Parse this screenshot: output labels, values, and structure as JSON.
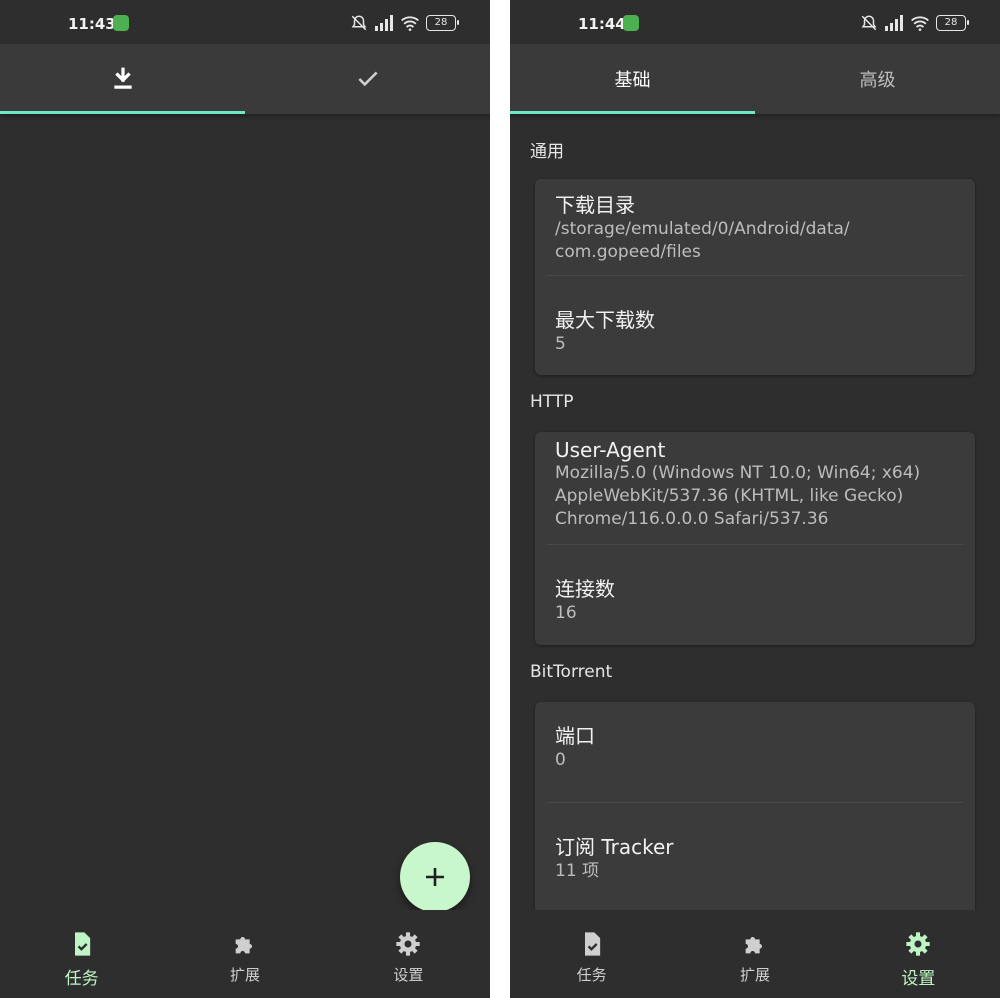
{
  "left": {
    "status": {
      "time": "11:43",
      "battery": "28"
    },
    "tabs": [
      {
        "icon": "download-icon",
        "active": true
      },
      {
        "icon": "check-icon",
        "active": false
      }
    ],
    "fab": {
      "icon": "plus-icon"
    },
    "nav": [
      {
        "label": "任务",
        "icon": "task-icon",
        "active": true
      },
      {
        "label": "扩展",
        "icon": "puzzle-icon",
        "active": false
      },
      {
        "label": "设置",
        "icon": "gear-icon",
        "active": false
      }
    ]
  },
  "right": {
    "status": {
      "time": "11:44",
      "battery": "28"
    },
    "tabs": [
      {
        "label": "基础",
        "active": true
      },
      {
        "label": "高级",
        "active": false
      }
    ],
    "sections": [
      {
        "title": "通用",
        "items": [
          {
            "title": "下载目录",
            "lines": [
              "/storage/emulated/0/Android/data/",
              "com.gopeed/files"
            ]
          },
          {
            "title": "最大下载数",
            "lines": [
              "5"
            ]
          }
        ]
      },
      {
        "title": "HTTP",
        "items": [
          {
            "title": "User-Agent",
            "lines": [
              "Mozilla/5.0 (Windows NT 10.0; Win64; x64)",
              "AppleWebKit/537.36 (KHTML, like Gecko)",
              "Chrome/116.0.0.0 Safari/537.36"
            ]
          },
          {
            "title": "连接数",
            "lines": [
              "16"
            ]
          }
        ]
      },
      {
        "title": "BitTorrent",
        "items": [
          {
            "title": "端口",
            "lines": [
              "0"
            ]
          },
          {
            "title": "订阅 Tracker",
            "lines": [
              "11 项"
            ]
          }
        ]
      }
    ],
    "nav": [
      {
        "label": "任务",
        "icon": "task-icon",
        "active": false
      },
      {
        "label": "扩展",
        "icon": "puzzle-icon",
        "active": false
      },
      {
        "label": "设置",
        "icon": "gear-icon",
        "active": true
      }
    ]
  },
  "colors": {
    "accent": "#6ee7c8",
    "fab": "#c8f7cc",
    "active_nav": "#bff5c4",
    "background": "#2e2e2e",
    "card": "#3b3b3b"
  }
}
